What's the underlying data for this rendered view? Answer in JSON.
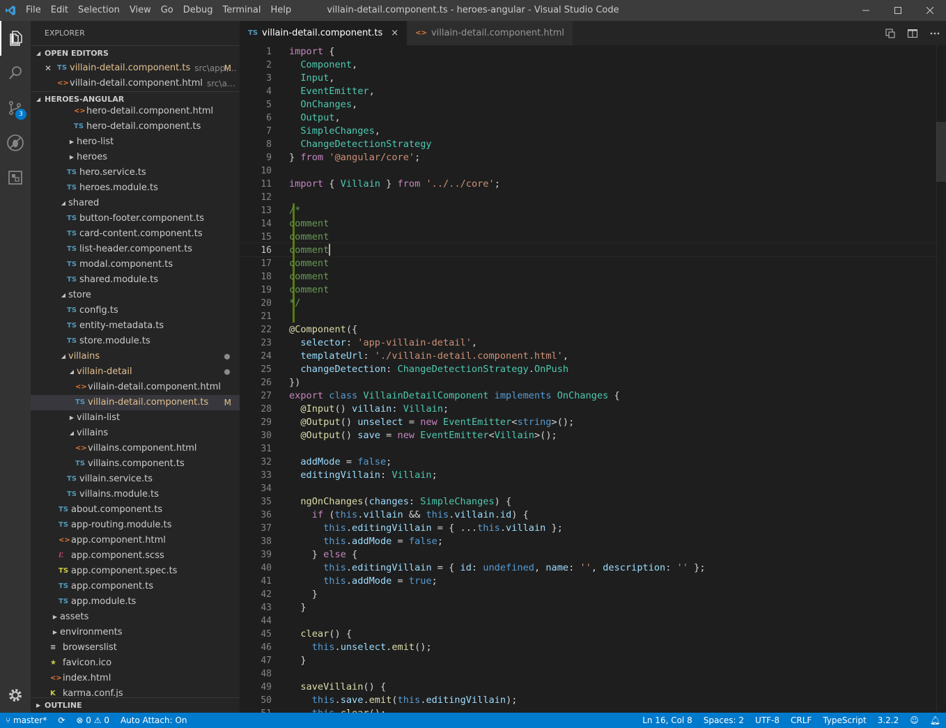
{
  "window": {
    "title": "villain-detail.component.ts - heroes-angular - Visual Studio Code",
    "menu": [
      "File",
      "Edit",
      "Selection",
      "View",
      "Go",
      "Debug",
      "Terminal",
      "Help"
    ]
  },
  "activity": {
    "scm_badge": "3"
  },
  "sidebar": {
    "title": "EXPLORER",
    "open_editors_header": "OPEN EDITORS",
    "open_editors": [
      {
        "icon": "TS",
        "name": "villain-detail.component.ts",
        "path": "src\\app\\v...",
        "flag": "M"
      },
      {
        "icon": "<>",
        "name": "villain-detail.component.html",
        "path": "src\\app\\vill..."
      }
    ],
    "project_header": "HEROES-ANGULAR",
    "tree": [
      {
        "icon": "<>",
        "name": "hero-detail.component.html"
      },
      {
        "icon": "TS",
        "name": "hero-detail.component.ts"
      },
      {
        "twisty": "▶",
        "name": "hero-list"
      },
      {
        "twisty": "▶",
        "name": "heroes"
      },
      {
        "icon": "TS",
        "name": "hero.service.ts"
      },
      {
        "icon": "TS",
        "name": "heroes.module.ts"
      },
      {
        "twisty": "◢",
        "name": "shared"
      },
      {
        "icon": "TS",
        "name": "button-footer.component.ts"
      },
      {
        "icon": "TS",
        "name": "card-content.component.ts"
      },
      {
        "icon": "TS",
        "name": "list-header.component.ts"
      },
      {
        "icon": "TS",
        "name": "modal.component.ts"
      },
      {
        "icon": "TS",
        "name": "shared.module.ts"
      },
      {
        "twisty": "◢",
        "name": "store"
      },
      {
        "icon": "TS",
        "name": "config.ts"
      },
      {
        "icon": "TS",
        "name": "entity-metadata.ts"
      },
      {
        "icon": "TS",
        "name": "store.module.ts"
      },
      {
        "twisty": "◢",
        "name": "villains"
      },
      {
        "twisty": "◢",
        "name": "villain-detail"
      },
      {
        "icon": "<>",
        "name": "villain-detail.component.html"
      },
      {
        "icon": "TS",
        "name": "villain-detail.component.ts",
        "flag": "M"
      },
      {
        "twisty": "▶",
        "name": "villain-list"
      },
      {
        "twisty": "◢",
        "name": "villains"
      },
      {
        "icon": "<>",
        "name": "villains.component.html"
      },
      {
        "icon": "TS",
        "name": "villains.component.ts"
      },
      {
        "icon": "TS",
        "name": "villain.service.ts"
      },
      {
        "icon": "TS",
        "name": "villains.module.ts"
      },
      {
        "icon": "TS",
        "name": "about.component.ts"
      },
      {
        "icon": "TS",
        "name": "app-routing.module.ts"
      },
      {
        "icon": "<>",
        "name": "app.component.html"
      },
      {
        "icon": "app.component.scss"
      },
      {
        "icon": "TS",
        "name": "app.component.spec.ts"
      },
      {
        "icon": "TS",
        "name": "app.component.ts"
      },
      {
        "icon": "TS",
        "name": "app.module.ts"
      },
      {
        "twisty": "▶",
        "name": "assets"
      },
      {
        "twisty": "▶",
        "name": "environments"
      },
      {
        "icon": "≡",
        "name": "browserslist"
      },
      {
        "icon": "★",
        "name": "favicon.ico"
      },
      {
        "icon": "<>",
        "name": "index.html"
      },
      {
        "icon": "K",
        "name": "karma.conf.js"
      }
    ],
    "outline_header": "OUTLINE"
  },
  "tabs": [
    {
      "icon": "TS",
      "label": "villain-detail.component.ts",
      "close": "×"
    },
    {
      "icon": "<>",
      "label": "villain-detail.component.html"
    }
  ],
  "editor": {
    "current_line": 16,
    "line_numbers": [
      "1",
      "2",
      "3",
      "4",
      "5",
      "6",
      "7",
      "8",
      "9",
      "10",
      "11",
      "12",
      "13",
      "14",
      "15",
      "16",
      "17",
      "18",
      "19",
      "20",
      "21",
      "22",
      "23",
      "24",
      "25",
      "26",
      "27",
      "28",
      "29",
      "30",
      "31",
      "32",
      "33",
      "34",
      "35",
      "36",
      "37",
      "38",
      "39",
      "40",
      "41",
      "42",
      "43",
      "44",
      "45",
      "46",
      "47",
      "48",
      "49",
      "50",
      "51"
    ],
    "lines": [
      "import {",
      "  Component,",
      "  Input,",
      "  EventEmitter,",
      "  OnChanges,",
      "  Output,",
      "  SimpleChanges,",
      "  ChangeDetectionStrategy",
      "} from '@angular/core';",
      "",
      "import { Villain } from '../../core';",
      "",
      "/*",
      "comment",
      "comment",
      "comment",
      "comment",
      "comment",
      "comment",
      "*/",
      "",
      "@Component({",
      "  selector: 'app-villain-detail',",
      "  templateUrl: './villain-detail.component.html',",
      "  changeDetection: ChangeDetectionStrategy.OnPush",
      "})",
      "export class VillainDetailComponent implements OnChanges {",
      "  @Input() villain: Villain;",
      "  @Output() unselect = new EventEmitter<string>();",
      "  @Output() save = new EventEmitter<Villain>();",
      "",
      "  addMode = false;",
      "  editingVillain: Villain;",
      "",
      "  ngOnChanges(changes: SimpleChanges) {",
      "    if (this.villain && this.villain.id) {",
      "      this.editingVillain = { ...this.villain };",
      "      this.addMode = false;",
      "    } else {",
      "      this.editingVillain = { id: undefined, name: '', description: '' };",
      "      this.addMode = true;",
      "    }",
      "  }",
      "",
      "  clear() {",
      "    this.unselect.emit();",
      "  }",
      "",
      "  saveVillain() {",
      "    this.save.emit(this.editingVillain);",
      "    this.clear();"
    ]
  },
  "status": {
    "branch": "master*",
    "errors": "0",
    "warnings": "0",
    "auto_attach": "Auto Attach: On",
    "position": "Ln 16, Col 8",
    "spaces": "Spaces: 2",
    "encoding": "UTF-8",
    "eol": "CRLF",
    "language": "TypeScript",
    "version": "3.2.2"
  },
  "colors": {
    "accent": "#007acc",
    "titlebar": "#3c3c3c",
    "activitybar": "#333333",
    "sidebar": "#252526",
    "editor": "#1e1e1e",
    "modified": "#e2c08d"
  }
}
